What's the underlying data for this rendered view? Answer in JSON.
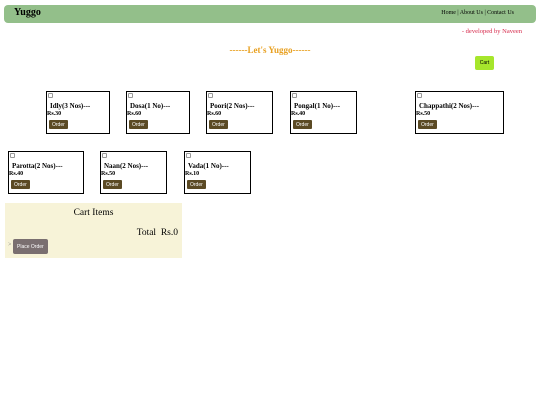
{
  "header": {
    "brand": "Yuggo",
    "nav": [
      "Home",
      "About Us",
      "Contact Us"
    ],
    "nav_separator": " | "
  },
  "developer_credit": "- developed by Naveen",
  "headline": "------Let's Yuggo------",
  "cart_button": "Cart",
  "menu_items": [
    {
      "name": "Idly(3 Nos)---",
      "price": "Rs.30",
      "order_label": "Order"
    },
    {
      "name": "Dosa(1 No)---",
      "price": "Rs.60",
      "order_label": "Order"
    },
    {
      "name": "Poori(2 Nos)---",
      "price": "Rs.60",
      "order_label": "Order"
    },
    {
      "name": "Pongal(1 No)---",
      "price": "Rs.40",
      "order_label": "Order"
    },
    {
      "name": "Chappathi(2 Nos)---",
      "price": "Rs.50",
      "order_label": "Order"
    },
    {
      "name": "Parotta(2 Nos)---",
      "price": "Rs.40",
      "order_label": "Order"
    },
    {
      "name": "Naan(2 Nos)---",
      "price": "Rs.50",
      "order_label": "Order"
    },
    {
      "name": "Vada(1 No)---",
      "price": "Rs.10",
      "order_label": "Order"
    }
  ],
  "cart": {
    "title": "Cart Items",
    "total_label": "Total",
    "total_value": "Rs.0",
    "place_order_label": "Place Order"
  },
  "colors": {
    "navbar": "#93bf8a",
    "headline": "#e8a020",
    "credit": "#d6284a",
    "cart_button": "#a6e62c",
    "order_button": "#5b4a24",
    "cart_panel": "#f7f3d8",
    "place_order_button": "#7a6f70"
  }
}
